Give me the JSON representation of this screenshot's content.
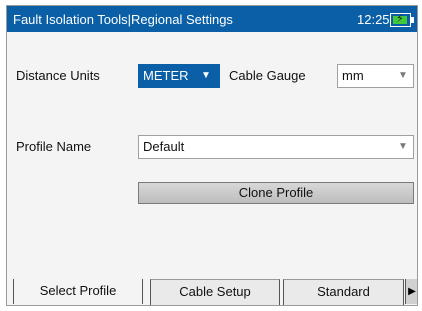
{
  "titlebar": {
    "title": "Fault Isolation Tools|Regional Settings",
    "clock": "12:25",
    "battery_icon": "battery-charging-icon"
  },
  "settings": {
    "distance_units_label": "Distance Units",
    "distance_units_value": "METER",
    "cable_gauge_label": "Cable Gauge",
    "cable_gauge_value": "mm",
    "profile_name_label": "Profile Name",
    "profile_name_value": "Default",
    "clone_button_label": "Clone Profile"
  },
  "tabs": [
    {
      "label": "Select Profile",
      "active": true
    },
    {
      "label": "Cable Setup",
      "active": false
    },
    {
      "label": "Standard",
      "active": false
    }
  ],
  "colors": {
    "titlebar": "#0a5fa6",
    "battery_fill": "#42c93b"
  }
}
